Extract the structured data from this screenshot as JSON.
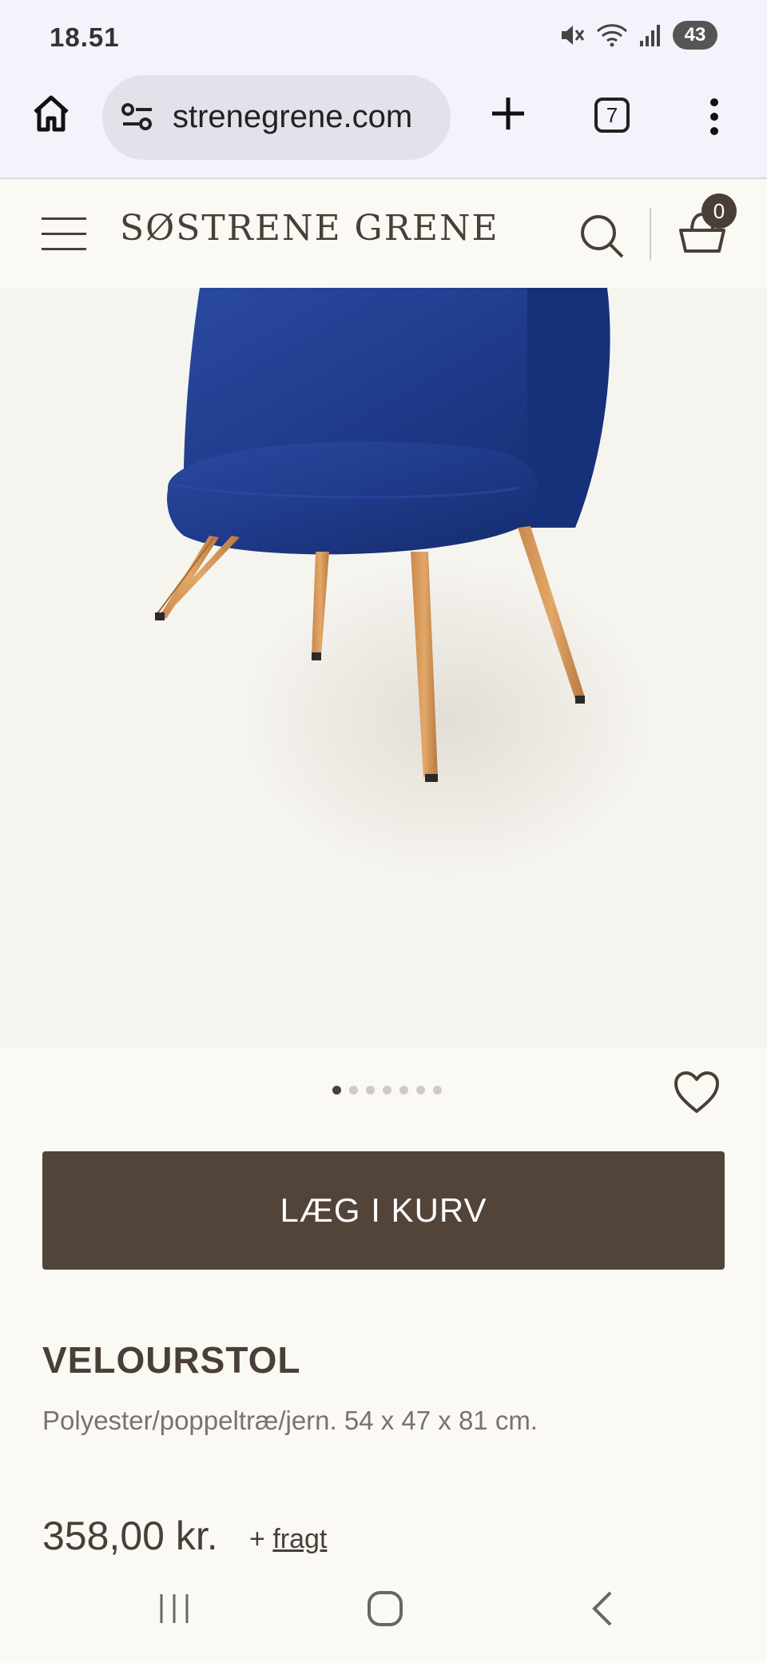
{
  "status": {
    "time": "18.51",
    "battery": "43"
  },
  "browser": {
    "url": "strenegrene.com",
    "tab_count": "7"
  },
  "site": {
    "logo": "SØSTRENE GRENE",
    "cart_count": "0"
  },
  "gallery": {
    "dot_count": 7,
    "active_dot": 0
  },
  "product": {
    "add_to_cart_label": "LÆG I KURV",
    "title": "VELOURSTOL",
    "description": "Polyester/poppeltræ/jern. 54 x 47 x 81 cm.",
    "price": "358,00 kr.",
    "shipping_prefix": "+",
    "shipping_link": "fragt"
  },
  "colors": {
    "brand": "#4a3f38",
    "cta": "#53443a",
    "chair": "#1f3a8a"
  }
}
